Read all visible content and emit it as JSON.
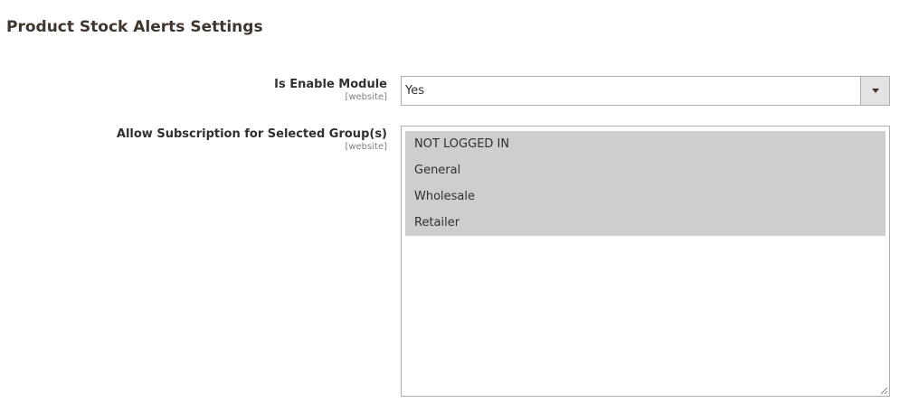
{
  "section": {
    "title": "Product Stock Alerts Settings"
  },
  "enable_module": {
    "label": "Is Enable Module",
    "scope": "[website]",
    "value": "Yes",
    "arrow_icon": "chevron-down-icon"
  },
  "subscription_groups": {
    "label": "Allow Subscription for Selected Group(s)",
    "scope": "[website]",
    "options": [
      {
        "label": "NOT LOGGED IN",
        "selected": true
      },
      {
        "label": "General",
        "selected": true
      },
      {
        "label": "Wholesale",
        "selected": true
      },
      {
        "label": "Retailer",
        "selected": true
      }
    ]
  },
  "colors": {
    "title_text": "#41362f",
    "selected_option_bg": "#cecece",
    "border": "#adadad"
  }
}
